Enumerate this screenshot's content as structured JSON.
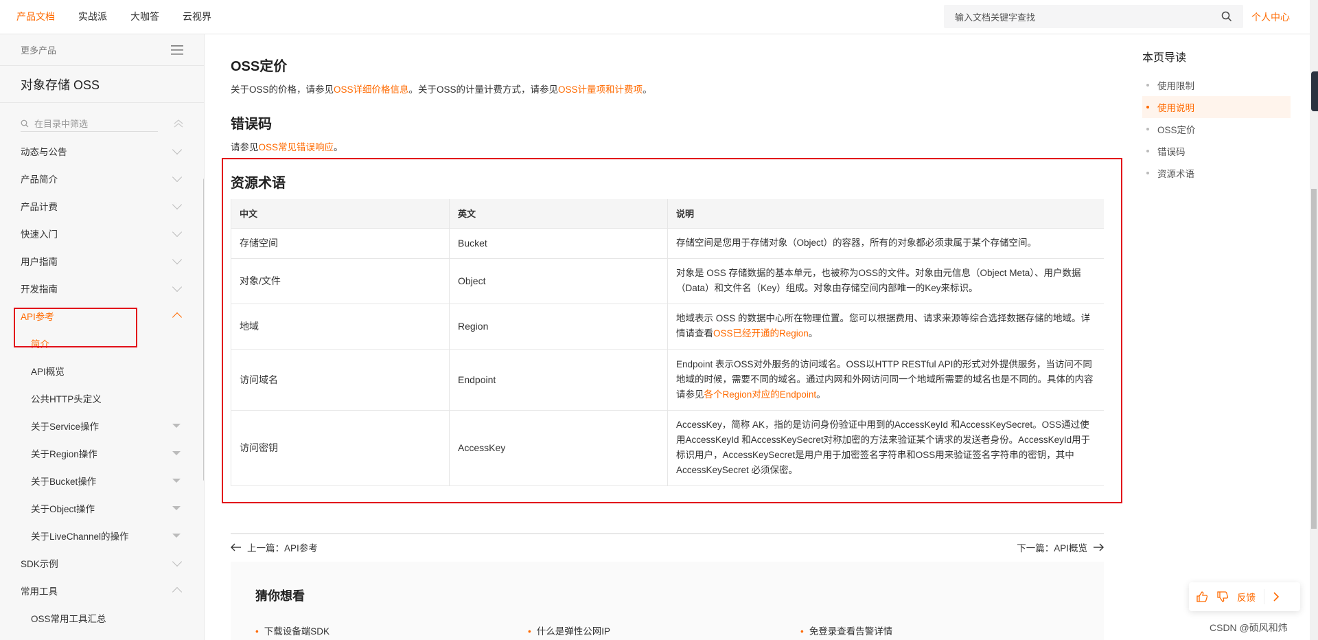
{
  "topbar": {
    "nav": [
      "产品文档",
      "实战派",
      "大咖答",
      "云视界"
    ],
    "search_placeholder": "输入文档关键字查找",
    "user_center": "个人中心"
  },
  "sidebar": {
    "more_products": "更多产品",
    "product_title": "对象存储 OSS",
    "filter_placeholder": "在目录中筛选",
    "items": [
      {
        "label": "动态与公告"
      },
      {
        "label": "产品简介"
      },
      {
        "label": "产品计费"
      },
      {
        "label": "快速入门"
      },
      {
        "label": "用户指南"
      },
      {
        "label": "开发指南"
      },
      {
        "label": "API参考"
      },
      {
        "label": "简介"
      },
      {
        "label": "API概览"
      },
      {
        "label": "公共HTTP头定义"
      },
      {
        "label": "关于Service操作"
      },
      {
        "label": "关于Region操作"
      },
      {
        "label": "关于Bucket操作"
      },
      {
        "label": "关于Object操作"
      },
      {
        "label": "关于LiveChannel的操作"
      },
      {
        "label": "SDK示例"
      },
      {
        "label": "常用工具"
      },
      {
        "label": "OSS常用工具汇总"
      }
    ]
  },
  "content": {
    "pricing": {
      "heading": "OSS定价",
      "t1": "关于OSS的价格，请参见",
      "link1": "OSS详细价格信息",
      "t2": "。关于OSS的计量计费方式，请参见",
      "link2": "OSS计量项和计费项",
      "t3": "。"
    },
    "errors": {
      "heading": "错误码",
      "t1": "请参见",
      "link1": "OSS常见错误响应",
      "t2": "。"
    },
    "terms": {
      "heading": "资源术语",
      "columns": [
        "中文",
        "英文",
        "说明"
      ],
      "rows": [
        {
          "zh": "存储空间",
          "en": "Bucket",
          "desc": "存储空间是您用于存储对象（Object）的容器，所有的对象都必须隶属于某个存储空间。"
        },
        {
          "zh": "对象/文件",
          "en": "Object",
          "desc": "对象是 OSS 存储数据的基本单元，也被称为OSS的文件。对象由元信息（Object Meta）、用户数据（Data）和文件名（Key）组成。对象由存储空间内部唯一的Key来标识。"
        },
        {
          "zh": "地域",
          "en": "Region",
          "desc": "地域表示 OSS 的数据中心所在物理位置。您可以根据费用、请求来源等综合选择数据存储的地域。详情请查看",
          "link": "OSS已经开通的Region",
          "desc_end": "。"
        },
        {
          "zh": "访问域名",
          "en": "Endpoint",
          "desc": "Endpoint 表示OSS对外服务的访问域名。OSS以HTTP RESTful API的形式对外提供服务，当访问不同地域的时候，需要不同的域名。通过内网和外网访问同一个地域所需要的域名也是不同的。具体的内容请参见",
          "link": "各个Region对应的Endpoint",
          "desc_end": "。"
        },
        {
          "zh": "访问密钥",
          "en": "AccessKey",
          "desc": "AccessKey，简称 AK，指的是访问身份验证中用到的AccessKeyId 和AccessKeySecret。OSS通过使用AccessKeyId 和AccessKeySecret对称加密的方法来验证某个请求的发送者身份。AccessKeyId用于标识用户，AccessKeySecret是用户用于加密签名字符串和OSS用来验证签名字符串的密钥，其中AccessKeySecret 必须保密。"
        }
      ]
    },
    "pager": {
      "prev": "上一篇：API参考",
      "next": "下一篇：API概览"
    },
    "guess": {
      "heading": "猜你想看",
      "items": [
        "下载设备端SDK",
        "什么是弹性公网IP",
        "免登录查看告警详情"
      ]
    }
  },
  "toc": {
    "title": "本页导读",
    "items": [
      "使用限制",
      "使用说明",
      "OSS定价",
      "错误码",
      "资源术语"
    ],
    "active_index": 1
  },
  "feedback": {
    "label": "反馈"
  },
  "watermark": "CSDN @硕风和炜",
  "colors": {
    "accent": "#ff6a00",
    "highlight_border": "#e2101a"
  }
}
